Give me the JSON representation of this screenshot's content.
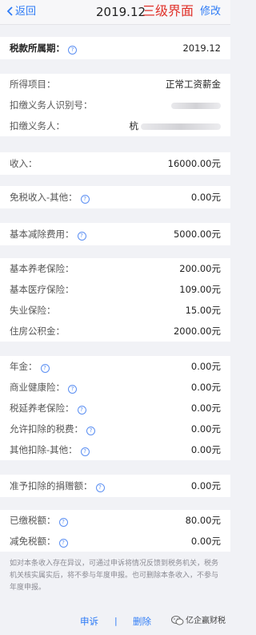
{
  "nav": {
    "back_label": "返回",
    "title": "2019.12",
    "annotation": "三级界面",
    "edit_label": "修改"
  },
  "period": {
    "label": "税款所属期：",
    "value": "2019.12"
  },
  "info": {
    "item_label": "所得项目：",
    "item_value": "正常工资薪金",
    "id_label": "扣缴义务人识别号：",
    "agent_label": "扣缴义务人：",
    "agent_value_partial": "杭"
  },
  "income": {
    "label": "收入：",
    "value": "16000.00元"
  },
  "tax_free": {
    "label": "免税收入-其他：",
    "value": "0.00元"
  },
  "basic_deduction": {
    "label": "基本减除费用：",
    "value": "5000.00元"
  },
  "insurance": [
    {
      "label": "基本养老保险：",
      "value": "200.00元"
    },
    {
      "label": "基本医疗保险：",
      "value": "109.00元"
    },
    {
      "label": "失业保险：",
      "value": "15.00元"
    },
    {
      "label": "住房公积金：",
      "value": "2000.00元"
    }
  ],
  "others": [
    {
      "label": "年金：",
      "value": "0.00元"
    },
    {
      "label": "商业健康险：",
      "value": "0.00元"
    },
    {
      "label": "税延养老保险：",
      "value": "0.00元"
    },
    {
      "label": "允许扣除的税费：",
      "value": "0.00元"
    },
    {
      "label": "其他扣除-其他：",
      "value": "0.00元"
    }
  ],
  "donation": {
    "label": "准予扣除的捐赠额：",
    "value": "0.00元"
  },
  "tax": [
    {
      "label": "已缴税额：",
      "value": "80.00元"
    },
    {
      "label": "减免税额：",
      "value": "0.00元"
    }
  ],
  "note": "如对本条收入存在异议，可通过申诉将情况反馈到税务机关，税务机关核实属实后，将不参与年度申报。也可删除本条收入，不参与年度申报。",
  "actions": {
    "appeal_label": "申诉",
    "separator": "|",
    "delete_label": "删除"
  },
  "watermark": "亿企赢财税",
  "colors": {
    "accent": "#2f7cf6",
    "annotation": "#e0312a",
    "background": "#f1f2f6"
  }
}
